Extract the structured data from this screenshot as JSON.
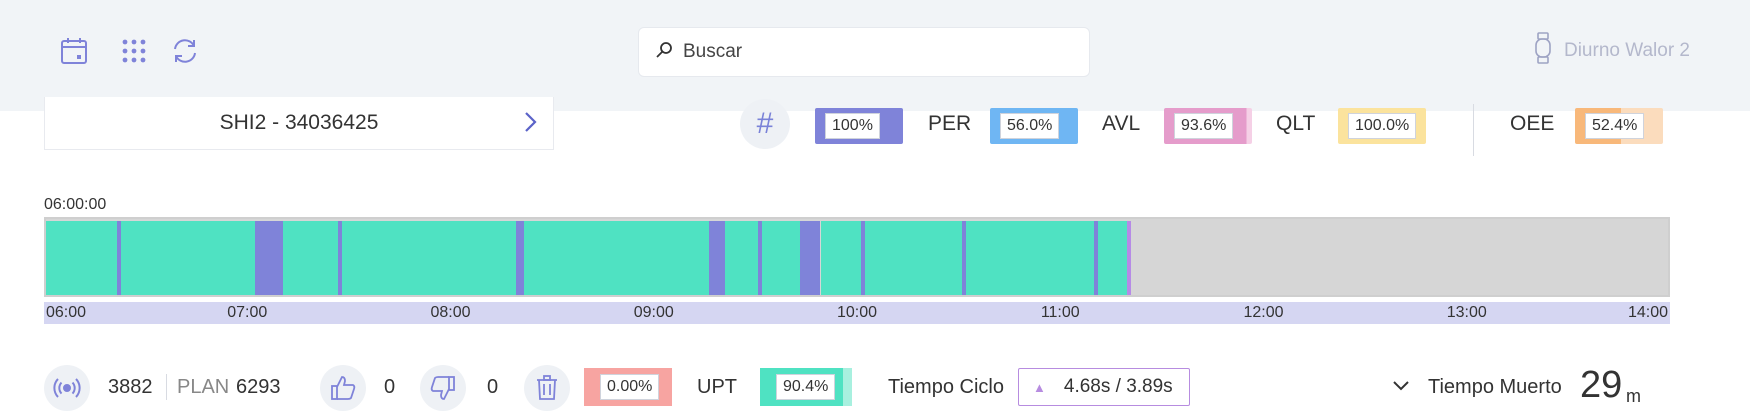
{
  "header": {
    "search_placeholder": "Buscar",
    "user_name": "Diurno Walor 2",
    "icons": [
      "calendar-icon",
      "grid-icon",
      "refresh-icon",
      "search-icon",
      "watch-icon"
    ]
  },
  "order": {
    "label": "SHI2 - 34036425"
  },
  "kpis": {
    "hash": "#",
    "main": {
      "value": "100%",
      "color": "#7f83d9",
      "fill": 1.0
    },
    "per": {
      "label": "PER",
      "value": "56.0%",
      "color": "#6fb6f3",
      "fill": 1.0
    },
    "avl": {
      "label": "AVL",
      "value": "93.6%",
      "color": "#e59ccb",
      "fill": 0.936,
      "track": "#f5d0e6"
    },
    "qlt": {
      "label": "QLT",
      "value": "100.0%",
      "color": "#fbe39d",
      "fill": 1.0
    },
    "oee": {
      "label": "OEE",
      "value": "52.4%",
      "color": "#f8b87a",
      "fill": 0.524,
      "track": "#fbdcbd"
    }
  },
  "timeline": {
    "start_label": "06:00:00",
    "ticks": [
      "06:00",
      "07:00",
      "08:00",
      "09:00",
      "10:00",
      "11:00",
      "12:00",
      "13:00",
      "14:00"
    ],
    "range_hours": [
      6,
      14
    ],
    "colors": {
      "run": "#4fe2c2",
      "stop": "#7f83d9",
      "end": "#b68ae6",
      "idle": "#d6d6d6"
    },
    "segments": [
      {
        "start": 6.0,
        "end": 6.35,
        "state": "run"
      },
      {
        "start": 6.35,
        "end": 6.37,
        "state": "stop"
      },
      {
        "start": 6.37,
        "end": 7.03,
        "state": "run"
      },
      {
        "start": 7.03,
        "end": 7.17,
        "state": "stop"
      },
      {
        "start": 7.17,
        "end": 7.44,
        "state": "run"
      },
      {
        "start": 7.44,
        "end": 7.46,
        "state": "stop"
      },
      {
        "start": 7.46,
        "end": 8.32,
        "state": "run"
      },
      {
        "start": 8.32,
        "end": 8.36,
        "state": "stop"
      },
      {
        "start": 8.36,
        "end": 9.27,
        "state": "run"
      },
      {
        "start": 9.27,
        "end": 9.35,
        "state": "stop"
      },
      {
        "start": 9.35,
        "end": 9.51,
        "state": "run"
      },
      {
        "start": 9.51,
        "end": 9.53,
        "state": "stop"
      },
      {
        "start": 9.53,
        "end": 9.72,
        "state": "run"
      },
      {
        "start": 9.72,
        "end": 9.82,
        "state": "stop"
      },
      {
        "start": 9.82,
        "end": 10.02,
        "state": "run"
      },
      {
        "start": 10.02,
        "end": 10.04,
        "state": "stop"
      },
      {
        "start": 10.04,
        "end": 10.52,
        "state": "run"
      },
      {
        "start": 10.52,
        "end": 10.54,
        "state": "stop"
      },
      {
        "start": 10.54,
        "end": 11.17,
        "state": "run"
      },
      {
        "start": 11.17,
        "end": 11.19,
        "state": "stop"
      },
      {
        "start": 11.19,
        "end": 11.33,
        "state": "run"
      },
      {
        "start": 11.33,
        "end": 11.35,
        "state": "end"
      }
    ]
  },
  "bottom": {
    "produced": "3882",
    "plan_label": "PLAN",
    "plan_value": "6293",
    "likes": "0",
    "dislikes": "0",
    "scrap": {
      "value": "0.00%",
      "color": "#f7a4a1"
    },
    "upt": {
      "label": "UPT",
      "value": "90.4%",
      "color": "#4fe2c2",
      "fill": 0.904,
      "track": "#a8f0df"
    },
    "cycle": {
      "label": "Tiempo Ciclo",
      "value": "4.68s  /  3.89s"
    },
    "dead": {
      "label": "Tiempo Muerto",
      "value": "29",
      "unit": "m"
    }
  }
}
